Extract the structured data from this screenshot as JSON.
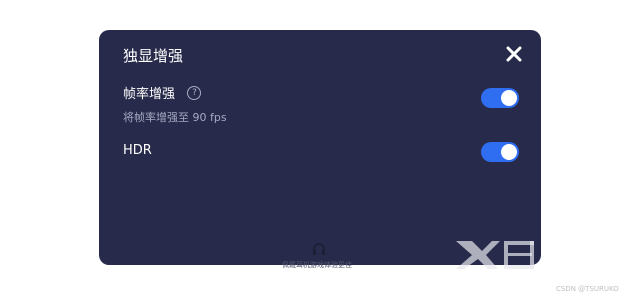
{
  "panel": {
    "title": "独显增强",
    "close_icon": "close-icon"
  },
  "settings": [
    {
      "label": "帧率增强",
      "help_icon": "help-icon",
      "help_glyph": "?",
      "description": "将帧率增强至 90 fps",
      "enabled": true
    },
    {
      "label": "HDR",
      "enabled": true
    }
  ],
  "footer": {
    "icon": "headset-icon",
    "hint": "佩戴耳机游戏体验更佳"
  },
  "watermark": {
    "text": "CSDN @TSURUKO"
  },
  "colors": {
    "panel_bg": "#272a4a",
    "toggle_on": "#2f6ef0",
    "text_primary": "#ffffff",
    "text_secondary": "#a7aac3"
  }
}
